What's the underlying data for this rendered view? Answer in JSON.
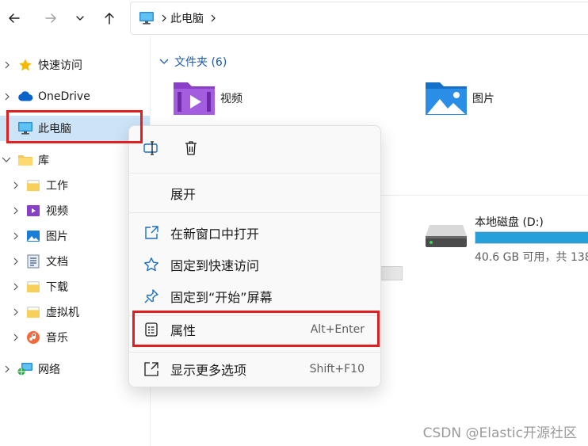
{
  "window": {
    "breadcrumb": [
      "此电脑"
    ]
  },
  "sidebar": {
    "items": [
      {
        "label": "快速访问",
        "icon": "star-icon"
      },
      {
        "label": "OneDrive",
        "icon": "cloud-icon"
      },
      {
        "label": "此电脑",
        "icon": "monitor-icon"
      },
      {
        "label": "库",
        "icon": "folder-icon"
      },
      {
        "label": "工作",
        "icon": "folder-icon"
      },
      {
        "label": "视频",
        "icon": "video-icon"
      },
      {
        "label": "图片",
        "icon": "picture-icon"
      },
      {
        "label": "文档",
        "icon": "document-icon"
      },
      {
        "label": "下载",
        "icon": "folder-icon"
      },
      {
        "label": "虚拟机",
        "icon": "folder-icon"
      },
      {
        "label": "音乐",
        "icon": "music-icon"
      },
      {
        "label": "网络",
        "icon": "network-icon"
      }
    ]
  },
  "main": {
    "group_title": "文件夹 (6)",
    "folders": [
      {
        "label": "视频",
        "icon": "video-folder-icon"
      },
      {
        "label": "图片",
        "icon": "picture-folder-icon"
      }
    ],
    "drive": {
      "name": "本地磁盘 (D:)",
      "free_text": "40.6 GB 可用，共 138",
      "used_fraction": 0.92
    }
  },
  "context_menu": {
    "quick_actions": [
      {
        "name": "rename-icon"
      },
      {
        "name": "trash-icon"
      }
    ],
    "items": [
      {
        "label": "展开",
        "shortcut": ""
      },
      {
        "label": "在新窗口中打开",
        "shortcut": ""
      },
      {
        "label": "固定到快速访问",
        "shortcut": ""
      },
      {
        "label": "固定到“开始”屏幕",
        "shortcut": ""
      },
      {
        "label": "属性",
        "shortcut": "Alt+Enter"
      },
      {
        "label": "显示更多选项",
        "shortcut": "Shift+F10"
      }
    ]
  },
  "watermark": "CSDN @Elastic开源社区",
  "colors": {
    "accent": "#1e5aa8",
    "selection": "#cce4f7",
    "drive_bar": "#26a0da",
    "highlight": "#e02020"
  }
}
